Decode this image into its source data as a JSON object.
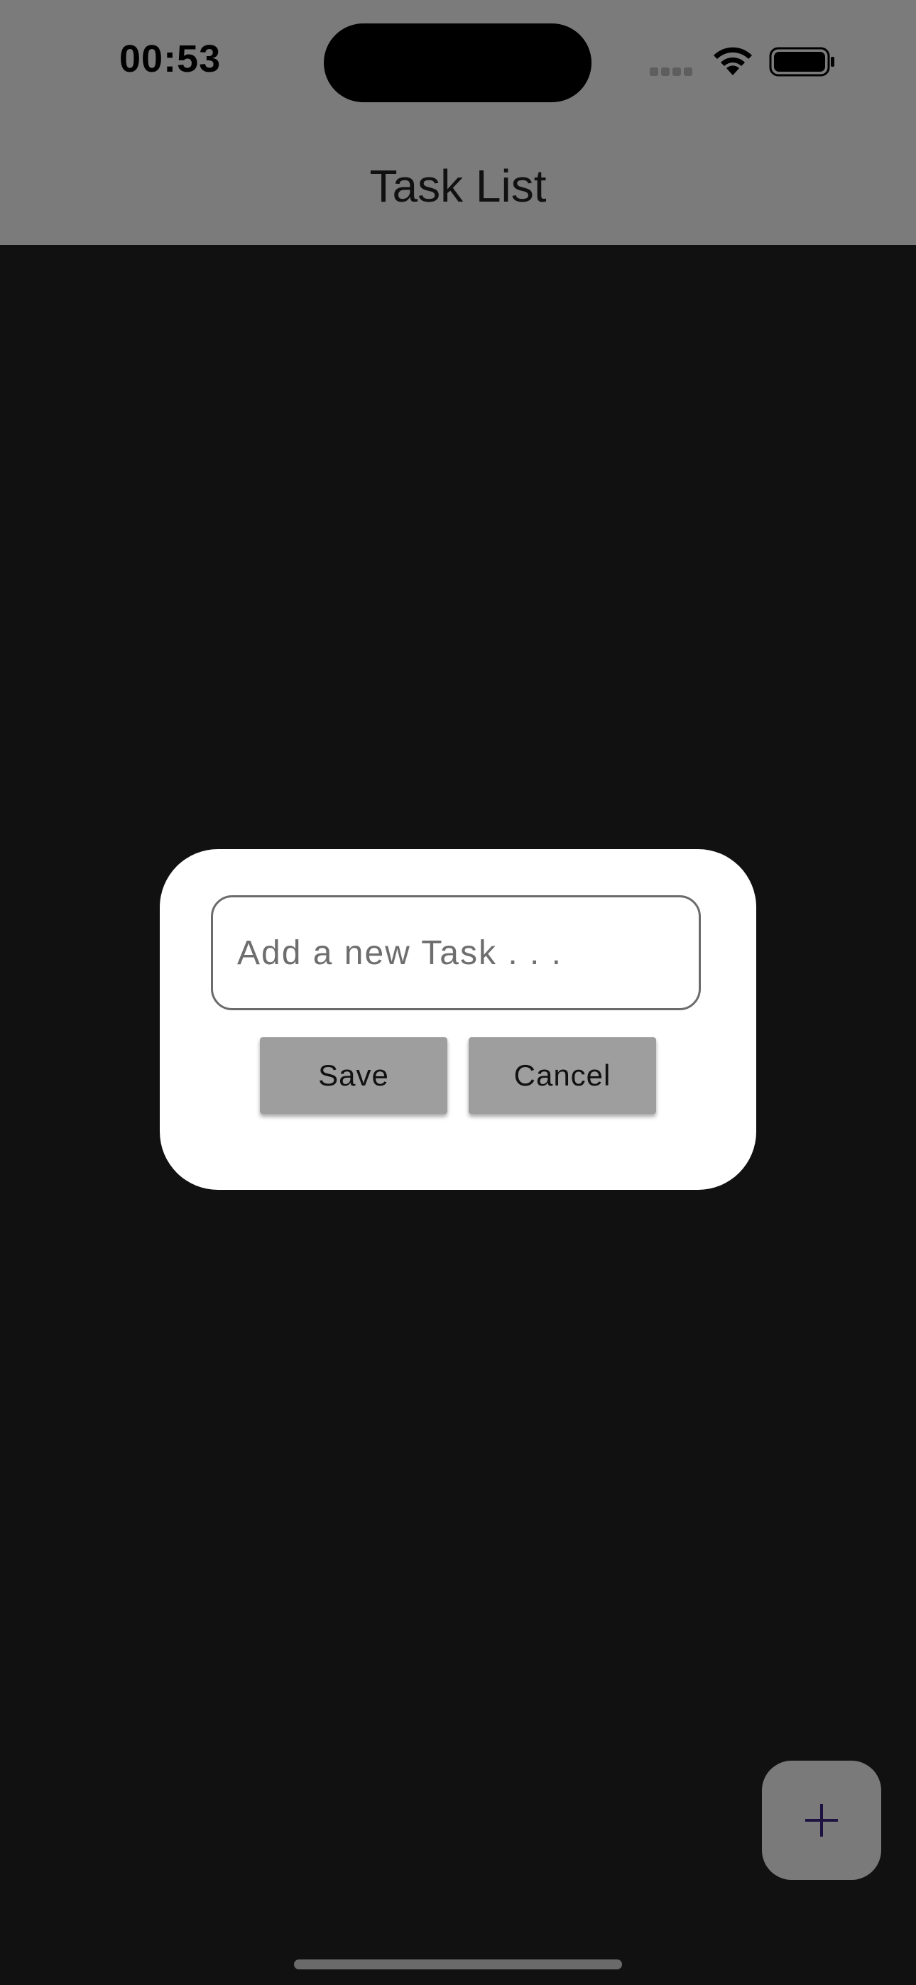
{
  "status_bar": {
    "time": "00:53",
    "icons": [
      "signal-icon",
      "wifi-icon",
      "battery-icon"
    ]
  },
  "app_bar": {
    "title": "Task List"
  },
  "dialog": {
    "input_placeholder": "Add a new Task . . .",
    "input_value": "",
    "save_label": "Save",
    "cancel_label": "Cancel"
  },
  "fab": {
    "icon": "plus-icon",
    "icon_color": "#1d1240"
  },
  "colors": {
    "background": "#111111",
    "app_bar_dimmed": "#7b7b7b",
    "dialog": "#ffffff",
    "button": "#9e9e9e"
  }
}
